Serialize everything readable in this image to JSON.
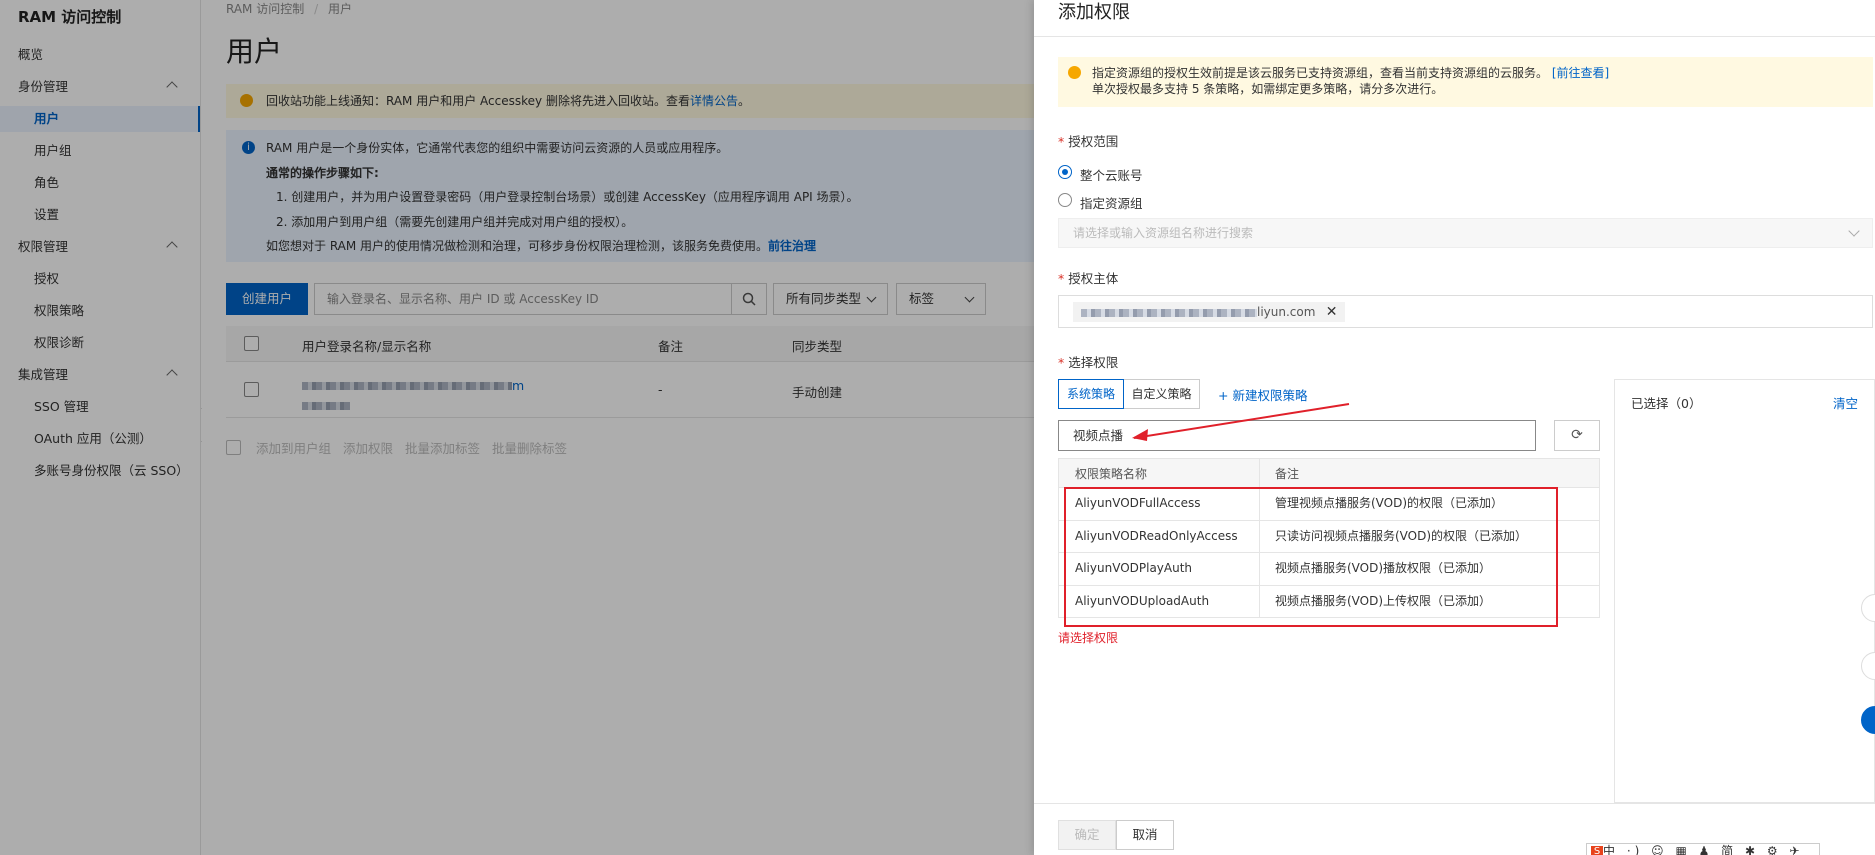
{
  "sidebar": {
    "title": "RAM 访问控制",
    "items": [
      {
        "label": "概览",
        "type": "top"
      },
      {
        "label": "身份管理",
        "type": "group"
      },
      {
        "label": "用户",
        "type": "child",
        "active": true
      },
      {
        "label": "用户组",
        "type": "child"
      },
      {
        "label": "角色",
        "type": "child"
      },
      {
        "label": "设置",
        "type": "child"
      },
      {
        "label": "权限管理",
        "type": "group"
      },
      {
        "label": "授权",
        "type": "child"
      },
      {
        "label": "权限策略",
        "type": "child"
      },
      {
        "label": "权限诊断",
        "type": "child"
      },
      {
        "label": "集成管理",
        "type": "group"
      },
      {
        "label": "SSO 管理",
        "type": "child"
      },
      {
        "label": "OAuth 应用（公测）",
        "type": "child"
      },
      {
        "label": "多账号身份权限（云 SSO）",
        "type": "child"
      }
    ],
    "collapse_glyph": "‹"
  },
  "main": {
    "breadcrumb": [
      "RAM 访问控制",
      "/",
      "用户"
    ],
    "page_title": "用户",
    "notice_yellow": {
      "text": "回收站功能上线通知：RAM 用户和用户 Accesskey 删除将先进入回收站。查看",
      "link": "详情公告",
      "tail": "。"
    },
    "notice_blue": {
      "line1": "RAM 用户是一个身份实体，它通常代表您的组织中需要访问云资源的人员或应用程序。",
      "line2": "通常的操作步骤如下:",
      "line3": "1. 创建用户，并为用户设置登录密码（用户登录控制台场景）或创建 AccessKey（应用程序调用 API 场景）。",
      "line4": "2. 添加用户到用户组（需要先创建用户组并完成对用户组的授权）。",
      "line5": "如您想对于 RAM 用户的使用情况做检测和治理，可移步身份权限治理检测，该服务免费使用。",
      "line5_link": "前往治理"
    },
    "create_user_label": "创建用户",
    "search_placeholder": "输入登录名、显示名称、用户 ID 或 AccessKey ID",
    "search_icon": "search-icon",
    "sync_type_dd": "所有同步类型",
    "tag_dd": "标签",
    "table": {
      "headers": [
        "用户登录名称/显示名称",
        "备注",
        "同步类型"
      ],
      "rows": [
        {
          "remark": "-",
          "sync": "手动创建",
          "name_suffix": "m"
        }
      ]
    },
    "bulk_actions": [
      "添加到用户组",
      "添加权限",
      "批量添加标签",
      "批量删除标签"
    ]
  },
  "drawer": {
    "title": "添加权限",
    "warning_line1": "指定资源组的授权生效前提是该云服务已支持资源组，查看当前支持资源组的云服务。",
    "warning_link": "[前往查看]",
    "warning_line2": "单次授权最多支持 5 条策略，如需绑定更多策略，请分多次进行。",
    "scope_label": "授权范围",
    "scope_options": [
      "整个云账号",
      "指定资源组"
    ],
    "scope_selected": "整个云账号",
    "rg_placeholder": "请选择或输入资源组名称进行搜索",
    "principal_label": "授权主体",
    "principal_tag_suffix": "liyun.com",
    "principal_remove": "✕",
    "select_policy_label": "选择权限",
    "tabs": [
      "系统策略",
      "自定义策略"
    ],
    "active_tab": "系统策略",
    "new_policy_label": "+ 新建权限策略",
    "policy_search_value": "视频点播",
    "refresh_icon": "refresh-icon",
    "refresh_glyph": "⟳",
    "policy_table": {
      "headers": [
        "权限策略名称",
        "备注"
      ],
      "rows": [
        {
          "name": "AliyunVODFullAccess",
          "note": "管理视频点播服务(VOD)的权限（已添加）"
        },
        {
          "name": "AliyunVODReadOnlyAccess",
          "note": "只读访问视频点播服务(VOD)的权限（已添加）"
        },
        {
          "name": "AliyunVODPlayAuth",
          "note": "视频点播服务(VOD)播放权限（已添加）"
        },
        {
          "name": "AliyunVODUploadAuth",
          "note": "视频点播服务(VOD)上传权限（已添加）"
        }
      ]
    },
    "error_text": "请选择权限",
    "selected_label": "已选择（0）",
    "clear_label": "清空",
    "ok_label": "确定",
    "cancel_label": "取消"
  },
  "ime": {
    "text": "中 ·) ☺ ▦ ♟ 简 ✱ ⚙ ✈"
  },
  "colors": {
    "primary": "#0064c8",
    "warning": "#f6a700",
    "annotation": "#e0202a",
    "overlay": "rgba(0,0,0,0.32)"
  }
}
